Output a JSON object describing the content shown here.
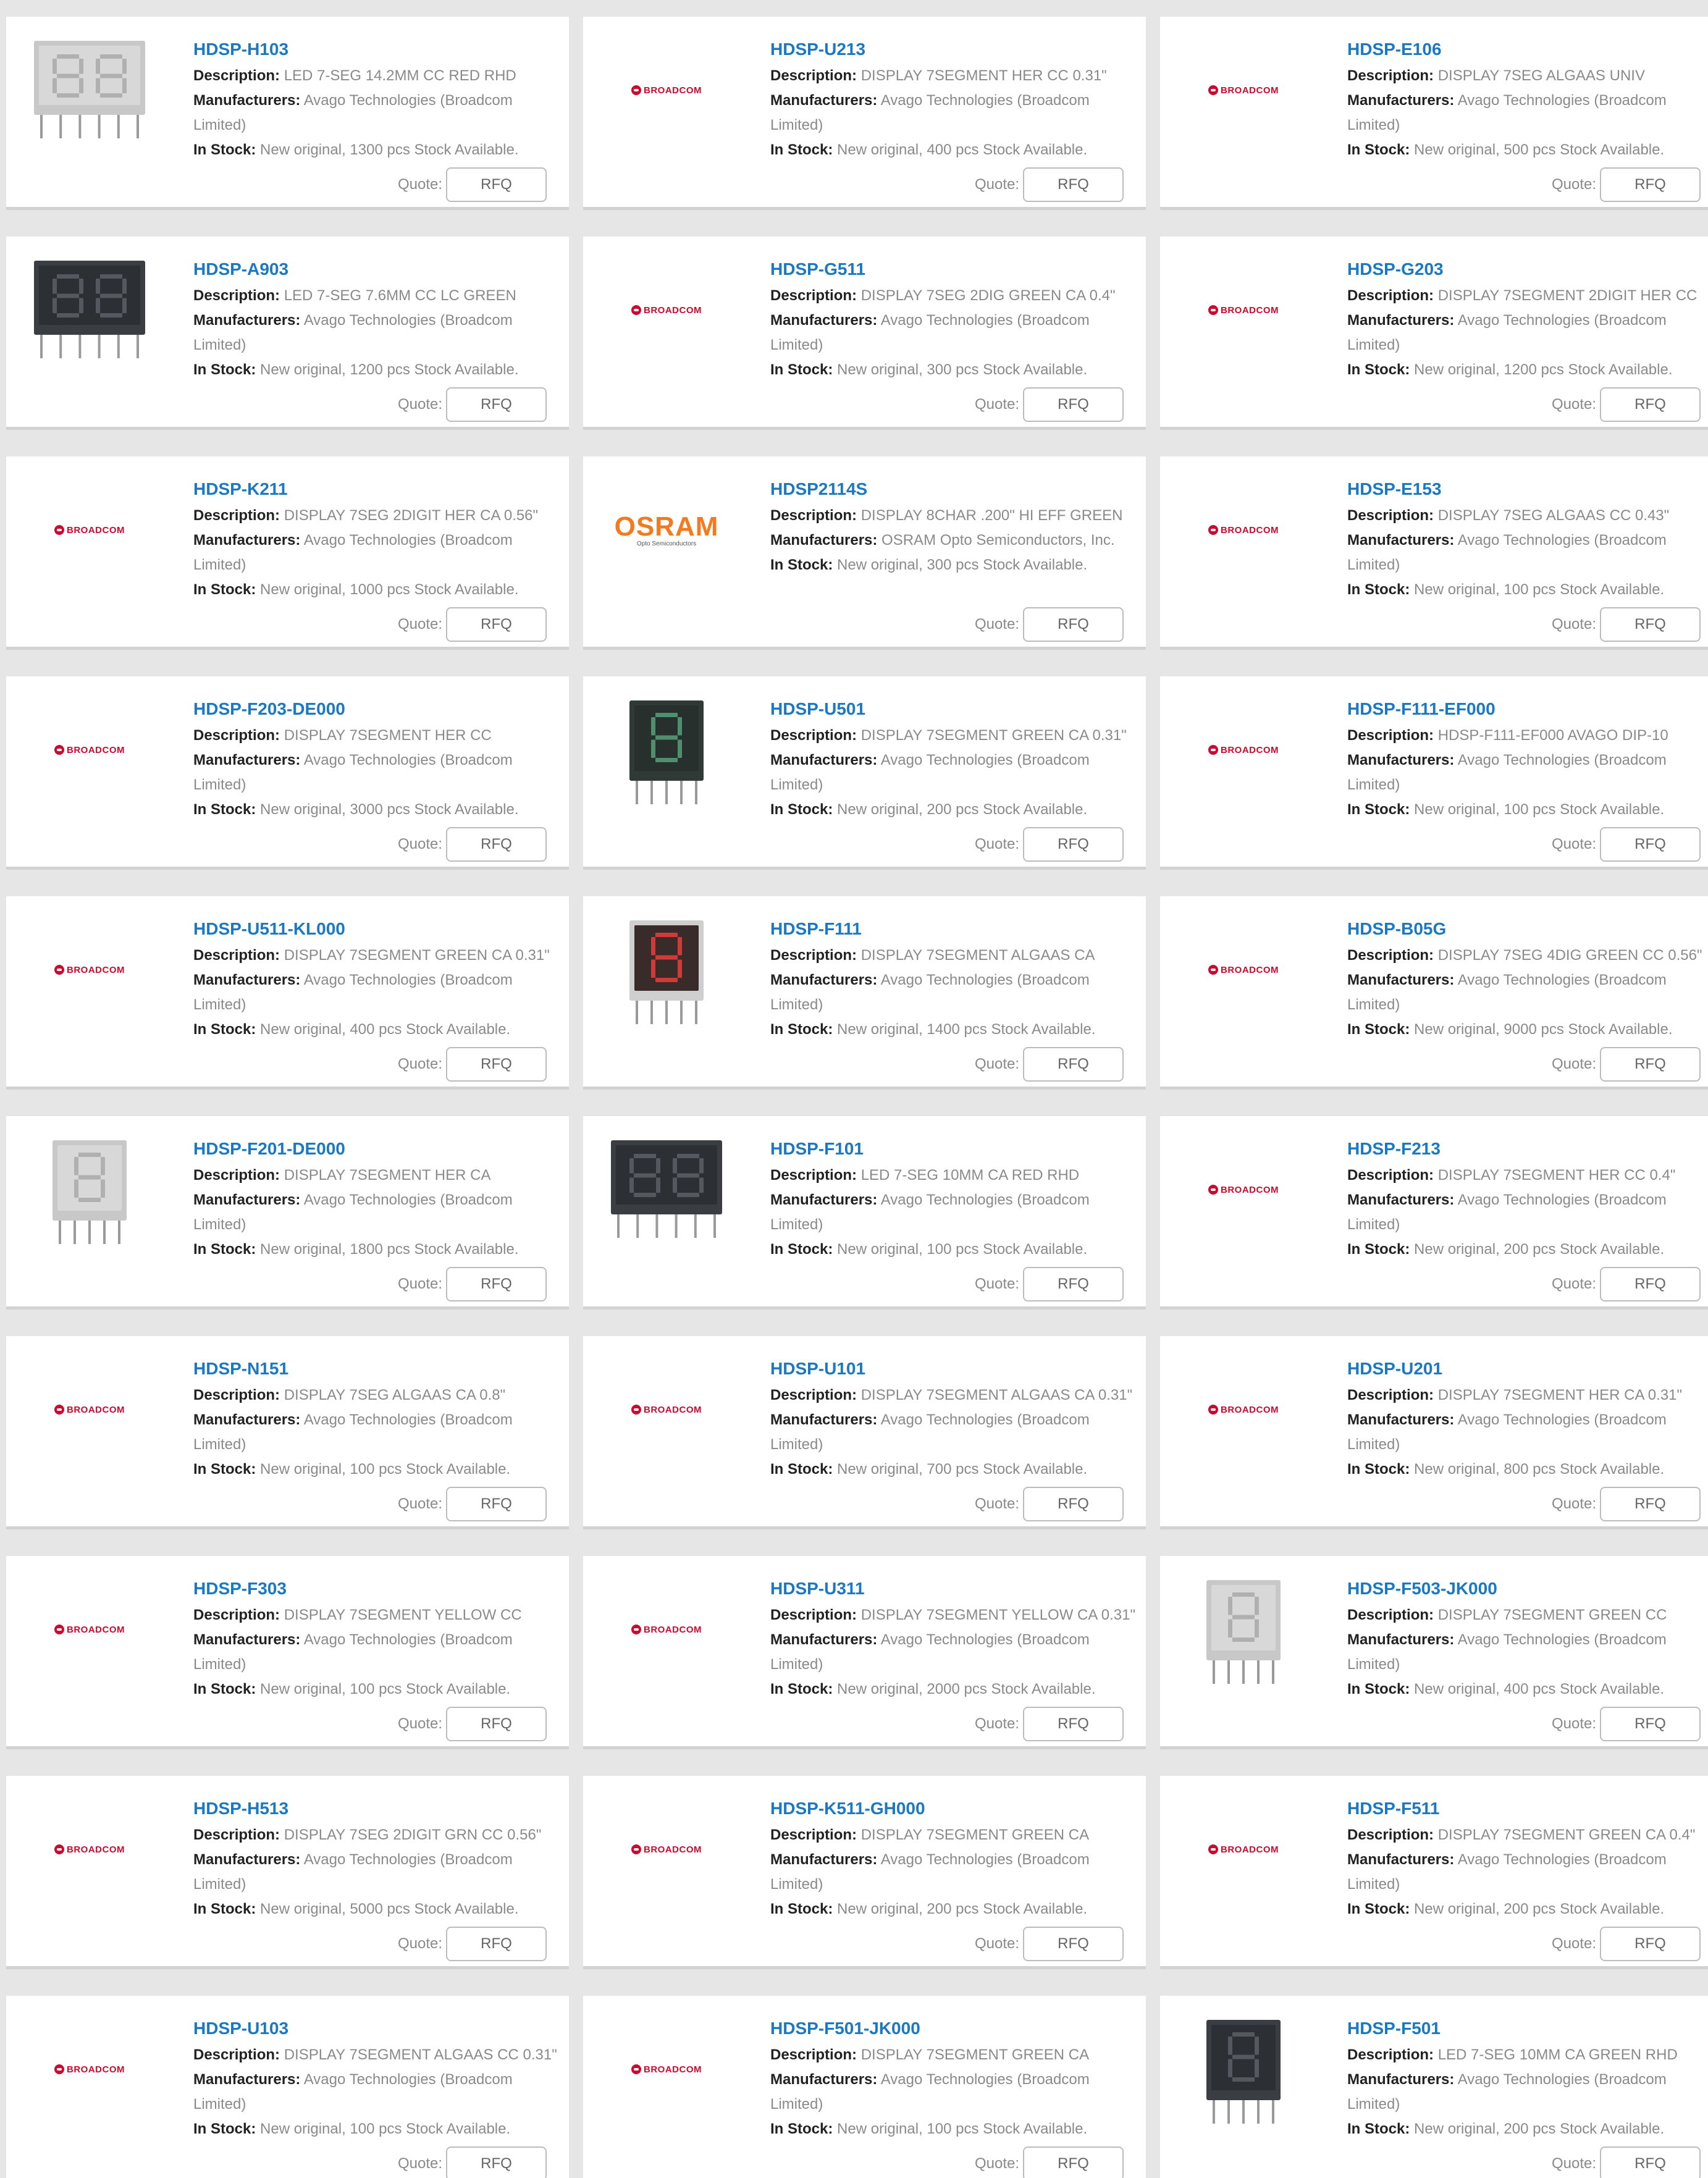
{
  "labels": {
    "description": "Description:",
    "manufacturers": "Manufacturers:",
    "in_stock": "In Stock:",
    "quote": "Quote:",
    "rfq": "RFQ"
  },
  "brand_logos": {
    "broadcom": "BROADCOM",
    "osram": "OSRAM",
    "osram_sub": "Opto Semiconductors"
  },
  "products": [
    {
      "part": "HDSP-H103",
      "description": "LED 7-SEG 14.2MM CC RED RHD",
      "mfr": "Avago Technologies (Broadcom",
      "mfr2": "Limited)",
      "stock": "New original, 1300 pcs Stock Available.",
      "thumb": "display-2digit-gray"
    },
    {
      "part": "HDSP-U213",
      "description": "DISPLAY 7SEGMENT HER CC 0.31\"",
      "mfr": "Avago Technologies (Broadcom",
      "mfr2": "Limited)",
      "stock": "New original, 400 pcs Stock Available.",
      "thumb": "broadcom"
    },
    {
      "part": "HDSP-E106",
      "description": "DISPLAY 7SEG ALGAAS UNIV",
      "mfr": "Avago Technologies (Broadcom",
      "mfr2": "Limited)",
      "stock": "New original, 500 pcs Stock Available.",
      "thumb": "broadcom"
    },
    {
      "part": "HDSP-A903",
      "description": "LED 7-SEG 7.6MM CC LC GREEN",
      "mfr": "Avago Technologies (Broadcom",
      "mfr2": "Limited)",
      "stock": "New original, 1200 pcs Stock Available.",
      "thumb": "display-2digit-dark"
    },
    {
      "part": "HDSP-G511",
      "description": "DISPLAY 7SEG 2DIG GREEN CA 0.4\"",
      "mfr": "Avago Technologies (Broadcom",
      "mfr2": "Limited)",
      "stock": "New original, 300 pcs Stock Available.",
      "thumb": "broadcom"
    },
    {
      "part": "HDSP-G203",
      "description": "DISPLAY 7SEGMENT 2DIGIT HER CC",
      "mfr": "Avago Technologies (Broadcom",
      "mfr2": "Limited)",
      "stock": "New original, 1200 pcs Stock Available.",
      "thumb": "broadcom"
    },
    {
      "part": "HDSP-K211",
      "description": "DISPLAY 7SEG 2DIGIT HER CA 0.56\"",
      "mfr": "Avago Technologies (Broadcom",
      "mfr2": "Limited)",
      "stock": "New original, 1000 pcs Stock Available.",
      "thumb": "broadcom"
    },
    {
      "part": "HDSP2114S",
      "description": "DISPLAY 8CHAR .200\" HI EFF GREEN",
      "mfr": "OSRAM Opto Semiconductors, Inc.",
      "mfr2": "",
      "stock": "New original, 300 pcs Stock Available.",
      "thumb": "osram"
    },
    {
      "part": "HDSP-E153",
      "description": "DISPLAY 7SEG ALGAAS CC 0.43\"",
      "mfr": "Avago Technologies (Broadcom",
      "mfr2": "Limited)",
      "stock": "New original, 100 pcs Stock Available.",
      "thumb": "broadcom"
    },
    {
      "part": "HDSP-F203-DE000",
      "description": "DISPLAY 7SEGMENT HER CC",
      "mfr": "Avago Technologies (Broadcom",
      "mfr2": "Limited)",
      "stock": "New original, 3000 pcs Stock Available.",
      "thumb": "broadcom"
    },
    {
      "part": "HDSP-U501",
      "description": "DISPLAY 7SEGMENT GREEN CA 0.31\"",
      "mfr": "Avago Technologies (Broadcom",
      "mfr2": "Limited)",
      "stock": "New original, 200 pcs Stock Available.",
      "thumb": "display-1digit-green"
    },
    {
      "part": "HDSP-F111-EF000",
      "description": "HDSP-F111-EF000 AVAGO DIP-10",
      "mfr": "Avago Technologies (Broadcom",
      "mfr2": "Limited)",
      "stock": "New original, 100 pcs Stock Available.",
      "thumb": "broadcom"
    },
    {
      "part": "HDSP-U511-KL000",
      "description": "DISPLAY 7SEGMENT GREEN CA 0.31\"",
      "mfr": "Avago Technologies (Broadcom",
      "mfr2": "Limited)",
      "stock": "New original, 400 pcs Stock Available.",
      "thumb": "broadcom"
    },
    {
      "part": "HDSP-F111",
      "description": "DISPLAY 7SEGMENT ALGAAS CA",
      "mfr": "Avago Technologies (Broadcom",
      "mfr2": "Limited)",
      "stock": "New original, 1400 pcs Stock Available.",
      "thumb": "display-1digit-red"
    },
    {
      "part": "HDSP-B05G",
      "description": "DISPLAY 7SEG 4DIG GREEN CC 0.56\"",
      "mfr": "Avago Technologies (Broadcom",
      "mfr2": "Limited)",
      "stock": "New original, 9000 pcs Stock Available.",
      "thumb": "broadcom"
    },
    {
      "part": "HDSP-F201-DE000",
      "description": "DISPLAY 7SEGMENT HER CA",
      "mfr": "Avago Technologies (Broadcom",
      "mfr2": "Limited)",
      "stock": "New original, 1800 pcs Stock Available.",
      "thumb": "display-1digit-gray"
    },
    {
      "part": "HDSP-F101",
      "description": "LED 7-SEG 10MM CA RED RHD",
      "mfr": "Avago Technologies (Broadcom",
      "mfr2": "Limited)",
      "stock": "New original, 100 pcs Stock Available.",
      "thumb": "display-2digit-dark"
    },
    {
      "part": "HDSP-F213",
      "description": "DISPLAY 7SEGMENT HER CC 0.4\"",
      "mfr": "Avago Technologies (Broadcom",
      "mfr2": "Limited)",
      "stock": "New original, 200 pcs Stock Available.",
      "thumb": "broadcom"
    },
    {
      "part": "HDSP-N151",
      "description": "DISPLAY 7SEG ALGAAS CA 0.8\"",
      "mfr": "Avago Technologies (Broadcom",
      "mfr2": "Limited)",
      "stock": "New original, 100 pcs Stock Available.",
      "thumb": "broadcom"
    },
    {
      "part": "HDSP-U101",
      "description": "DISPLAY 7SEGMENT ALGAAS CA 0.31\"",
      "mfr": "Avago Technologies (Broadcom",
      "mfr2": "Limited)",
      "stock": "New original, 700 pcs Stock Available.",
      "thumb": "broadcom"
    },
    {
      "part": "HDSP-U201",
      "description": "DISPLAY 7SEGMENT HER CA 0.31\"",
      "mfr": "Avago Technologies (Broadcom",
      "mfr2": "Limited)",
      "stock": "New original, 800 pcs Stock Available.",
      "thumb": "broadcom"
    },
    {
      "part": "HDSP-F303",
      "description": "DISPLAY 7SEGMENT YELLOW CC",
      "mfr": "Avago Technologies (Broadcom",
      "mfr2": "Limited)",
      "stock": "New original, 100 pcs Stock Available.",
      "thumb": "broadcom"
    },
    {
      "part": "HDSP-U311",
      "description": "DISPLAY 7SEGMENT YELLOW CA 0.31\"",
      "mfr": "Avago Technologies (Broadcom",
      "mfr2": "Limited)",
      "stock": "New original, 2000 pcs Stock Available.",
      "thumb": "broadcom"
    },
    {
      "part": "HDSP-F503-JK000",
      "description": "DISPLAY 7SEGMENT GREEN CC",
      "mfr": "Avago Technologies (Broadcom",
      "mfr2": "Limited)",
      "stock": "New original, 400 pcs Stock Available.",
      "thumb": "display-1digit-gray"
    },
    {
      "part": "HDSP-H513",
      "description": "DISPLAY 7SEG 2DIGIT GRN CC 0.56\"",
      "mfr": "Avago Technologies (Broadcom",
      "mfr2": "Limited)",
      "stock": "New original, 5000 pcs Stock Available.",
      "thumb": "broadcom"
    },
    {
      "part": "HDSP-K511-GH000",
      "description": "DISPLAY 7SEGMENT GREEN CA",
      "mfr": "Avago Technologies (Broadcom",
      "mfr2": "Limited)",
      "stock": "New original, 200 pcs Stock Available.",
      "thumb": "broadcom"
    },
    {
      "part": "HDSP-F511",
      "description": "DISPLAY 7SEGMENT GREEN CA 0.4\"",
      "mfr": "Avago Technologies (Broadcom",
      "mfr2": "Limited)",
      "stock": "New original, 200 pcs Stock Available.",
      "thumb": "broadcom"
    },
    {
      "part": "HDSP-U103",
      "description": "DISPLAY 7SEGMENT ALGAAS CC 0.31\"",
      "mfr": "Avago Technologies (Broadcom",
      "mfr2": "Limited)",
      "stock": "New original, 100 pcs Stock Available.",
      "thumb": "broadcom"
    },
    {
      "part": "HDSP-F501-JK000",
      "description": "DISPLAY 7SEGMENT GREEN CA",
      "mfr": "Avago Technologies (Broadcom",
      "mfr2": "Limited)",
      "stock": "New original, 100 pcs Stock Available.",
      "thumb": "broadcom"
    },
    {
      "part": "HDSP-F501",
      "description": "LED 7-SEG 10MM CA GREEN RHD",
      "mfr": "Avago Technologies (Broadcom",
      "mfr2": "Limited)",
      "stock": "New original, 200 pcs Stock Available.",
      "thumb": "display-1digit-dark"
    }
  ],
  "colors": {
    "page_bg": "#e6e6e6",
    "card_bg": "#ffffff",
    "part_link": "#1a79c2",
    "label": "#222222",
    "value": "#8a8a8a",
    "broadcom_red": "#cc092f",
    "osram_orange": "#f47a20"
  }
}
